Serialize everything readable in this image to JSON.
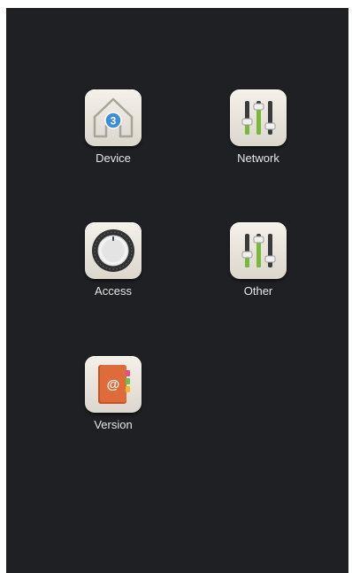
{
  "menu": {
    "items": [
      {
        "label": "Device",
        "icon": "house-icon",
        "badge": "3"
      },
      {
        "label": "Network",
        "icon": "sliders-icon"
      },
      {
        "label": "Access",
        "icon": "knob-icon"
      },
      {
        "label": "Other",
        "icon": "sliders-icon"
      },
      {
        "label": "Version",
        "icon": "address-book-icon",
        "glyph": "@"
      }
    ]
  },
  "colors": {
    "background": "#1e2023",
    "label_text": "#e6e6e6",
    "tile_face": "#ece8df",
    "badge_blue": "#3a8fd6",
    "slider_green": "#7ab83a",
    "book_orange": "#e06b3a"
  }
}
